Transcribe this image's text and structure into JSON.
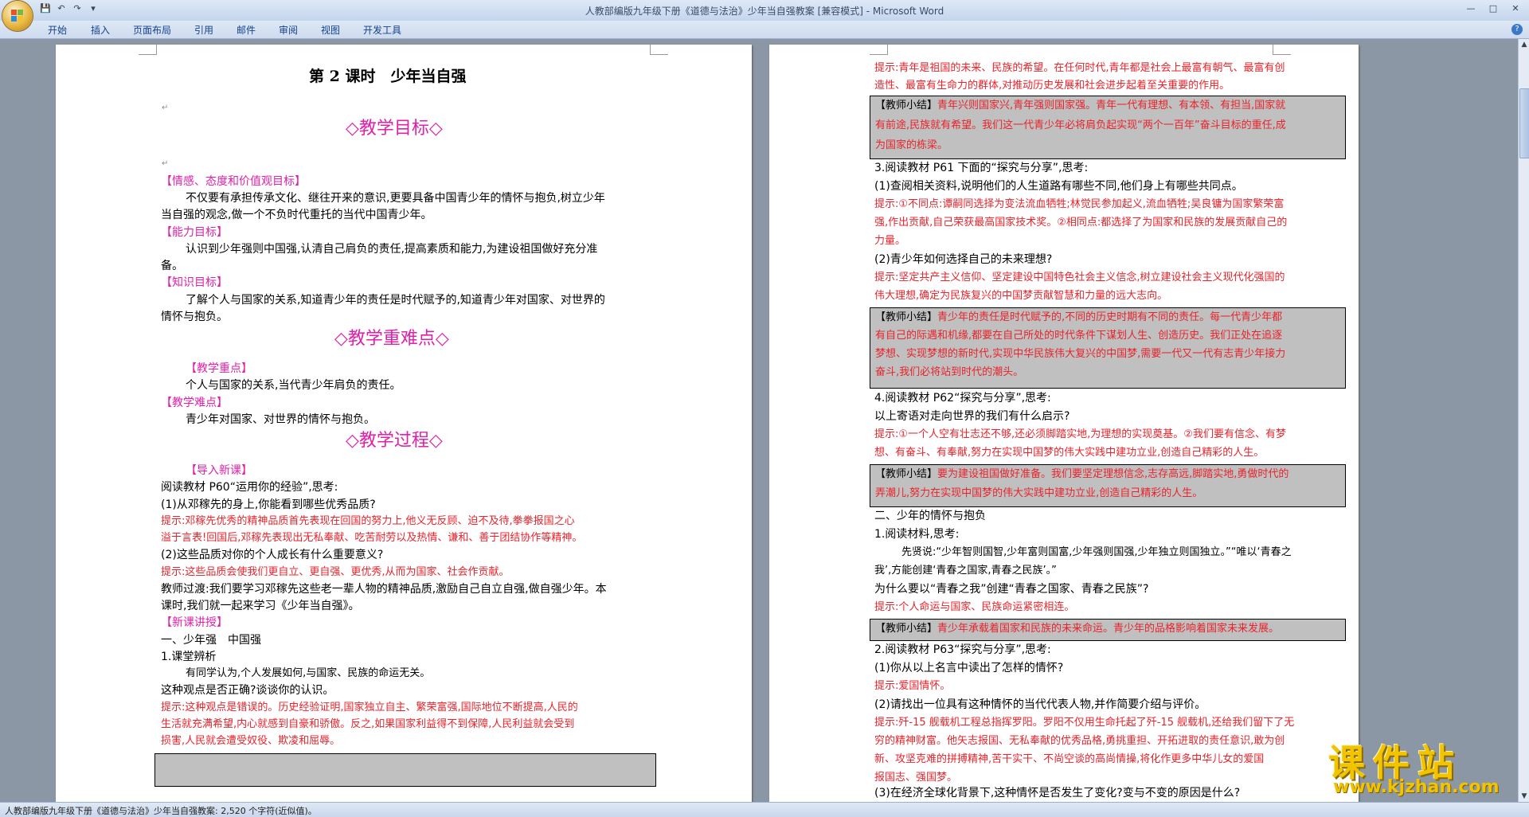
{
  "window": {
    "title": "人教部编版九年级下册《道德与法治》少年当自强教案 [兼容模式] - Microsoft Word"
  },
  "ribbon": {
    "tabs": [
      "开始",
      "插入",
      "页面布局",
      "引用",
      "邮件",
      "审阅",
      "视图",
      "开发工具"
    ]
  },
  "left_page": {
    "lines": [
      "第 2 课时　少年当自强",
      "◇教学目标◇",
      "【情感、态度和价值观目标】",
      "不仅要有承担传承文化、继往开来的意识,更要具备中国青少年的情怀与抱负,树立少年",
      "当自强的观念,做一个不负时代重托的当代中国青少年。",
      "【能力目标】",
      "认识到少年强则中国强,认清自己肩负的责任,提高素质和能力,为建设祖国做好充分准",
      "备。",
      "【知识目标】",
      "了解个人与国家的关系,知道青少年的责任是时代赋予的,知道青少年对国家、对世界的",
      "情怀与抱负。",
      "◇教学重难点◇",
      "【教学重点】",
      "个人与国家的关系,当代青少年肩负的责任。",
      "【教学难点】",
      "青少年对国家、对世界的情怀与抱负。",
      "◇教学过程◇",
      "【导入新课】",
      "阅读教材 P60“运用你的经验”,思考:",
      "(1)从邓稼先的身上,你能看到哪些优秀品质?",
      "提示:",
      "邓稼先优秀的精神品质首先表现在回国的努力上,他义无反顾、迫不及待,拳拳报国之心",
      "溢于言表!回国后,邓稼先表现出无私奉献、吃苦耐劳以及热情、谦和、善于团结协作等精神。",
      "(2)这些品质对你的个人成长有什么重要意义?",
      "提示:",
      "这些品质会使我们更自立、更自强、更优秀,从而为国家、社会作贡献。",
      "教师过渡:我们要学习邓稼先这些老一辈人物的精神品质,激励自己自立自强,做自强少年。本",
      "课时,我们就一起来学习《少年当自强》。",
      "【新课讲授】",
      "一、少年强　中国强",
      "1.课堂辨析",
      "有同学认为,个人发展如何,与国家、民族的命运无关。",
      "这种观点是否正确?谈谈你的认识。",
      "提示:",
      "这种观点是错误的。历史经验证明,国家独立自主、繁荣富强,国际地位不断提高,人民的",
      "生活就充满希望,内心就感到自豪和骄傲。反之,如果国家利益得不到保障,人民利益就会受到",
      "损害,人民就会遭受奴役、欺凌和屈辱。"
    ]
  },
  "right_page": {
    "lines": [
      "提示:",
      "青年是祖国的未来、民族的希望。在任何时代,青年都是社会上最富有朝气、最富有创",
      "造性、最富有生命力的群体,对推动历史发展和社会进步起着至关重要的作用。",
      "【教师小结】",
      "青年兴则国家兴,青年强则国家强。青年一代有理想、有本领、有担当,国家就",
      "有前途,民族就有希望。我们这一代青少年必将肩负起实现“两个一百年”奋斗目标的重任,成",
      "为国家的栋梁。",
      "3.阅读教材 P61 下面的“探究与分享”,思考:",
      "(1)查阅相关资料,说明他们的人生道路有哪些不同,他们身上有哪些共同点。",
      "提示:",
      "①不同点:谭嗣同选择为变法流血牺牲;林觉民参加起义,流血牺牲;吴良镛为国家繁荣富",
      "强,作出贡献,自己荣获最高国家技术奖。②相同点:都选择了为国家和民族的发展贡献自己的",
      "力量。",
      "(2)青少年如何选择自己的未来理想?",
      "提示:",
      "坚定共产主义信仰、坚定建设中国特色社会主义信念,树立建设社会主义现代化强国的",
      "伟大理想,确定为民族复兴的中国梦贡献智慧和力量的远大志向。",
      "【教师小结】",
      "青少年的责任是时代赋予的,不同的历史时期有不同的责任。每一代青少年都",
      "有自己的际遇和机缘,都要在自己所处的时代条件下谋划人生、创造历史。我们正处在追逐",
      "梦想、实现梦想的新时代,实现中华民族伟大复兴的中国梦,需要一代又一代有志青少年接力",
      "奋斗,我们必将站到时代的潮头。",
      "4.阅读教材 P62“探究与分享”,思考:",
      "以上寄语对走向世界的我们有什么启示?",
      "提示:",
      "①一个人空有壮志还不够,还必须脚踏实地,为理想的实现奠基。②我们要有信念、有梦",
      "想、有奋斗、有奉献,努力在实现中国梦的伟大实践中建功立业,创造自己精彩的人生。",
      "【教师小结】",
      "要为建设祖国做好准备。我们要坚定理想信念,志存高远,脚踏实地,勇做时代的",
      "弄潮儿,努力在实现中国梦的伟大实践中建功立业,创造自己精彩的人生。",
      "二、少年的情怀与抱负",
      "1.阅读材料,思考:",
      "先贤说:“少年智则国智,少年富则国富,少年强则国强,少年独立则国独立。”“唯以‘青春之",
      "我’,方能创建‘青春之国家,青春之民族’。”",
      "为什么要以“青春之我”创建“青春之国家、青春之民族”?",
      "提示:",
      "个人命运与国家、民族命运紧密相连。",
      "【教师小结】",
      "青少年承载着国家和民族的未来命运。青少年的品格影响着国家未来发展。",
      "2.阅读教材 P63“探究与分享”,思考:",
      "(1)你从以上名言中读出了怎样的情怀?",
      "提示:",
      "爱国情怀。",
      "(2)请找出一位具有这种情怀的当代代表人物,并作简要介绍与评价。",
      "提示:",
      "歼-15 舰载机工程总指挥罗阳。罗阳不仅用生命托起了歼-15 舰载机,还给我们留下了无",
      "穷的精神财富。他矢志报国、无私奉献的优秀品格,勇挑重担、开拓进取的责任意识,敢为创",
      "新、攻坚克难的拼搏精神,苦干实干、不尚空谈的高尚情操,将化作更多中华儿女的爱国",
      "报国志、强国梦。",
      "(3)在经济全球化背景下,这种情怀是否发生了变化?变与不变的原因是什么?"
    ]
  },
  "status": {
    "text": "人教部编版九年级下册《道德与法治》少年当自强教案: 2,520 个字符(近似值)。"
  },
  "watermark": {
    "title": "课件站",
    "url": "www.kjzhan.com"
  },
  "colors": {
    "prompt_red": "#e8232b",
    "heading_magenta": "#e020a8",
    "summary_box": "#c0c0c0"
  },
  "icons": [
    "office-button-icon",
    "save-icon",
    "undo-icon",
    "redo-icon",
    "customize-qat-icon",
    "minimize-icon",
    "maximize-icon",
    "close-icon",
    "help-icon",
    "scroll-up-icon",
    "scroll-down-icon"
  ]
}
